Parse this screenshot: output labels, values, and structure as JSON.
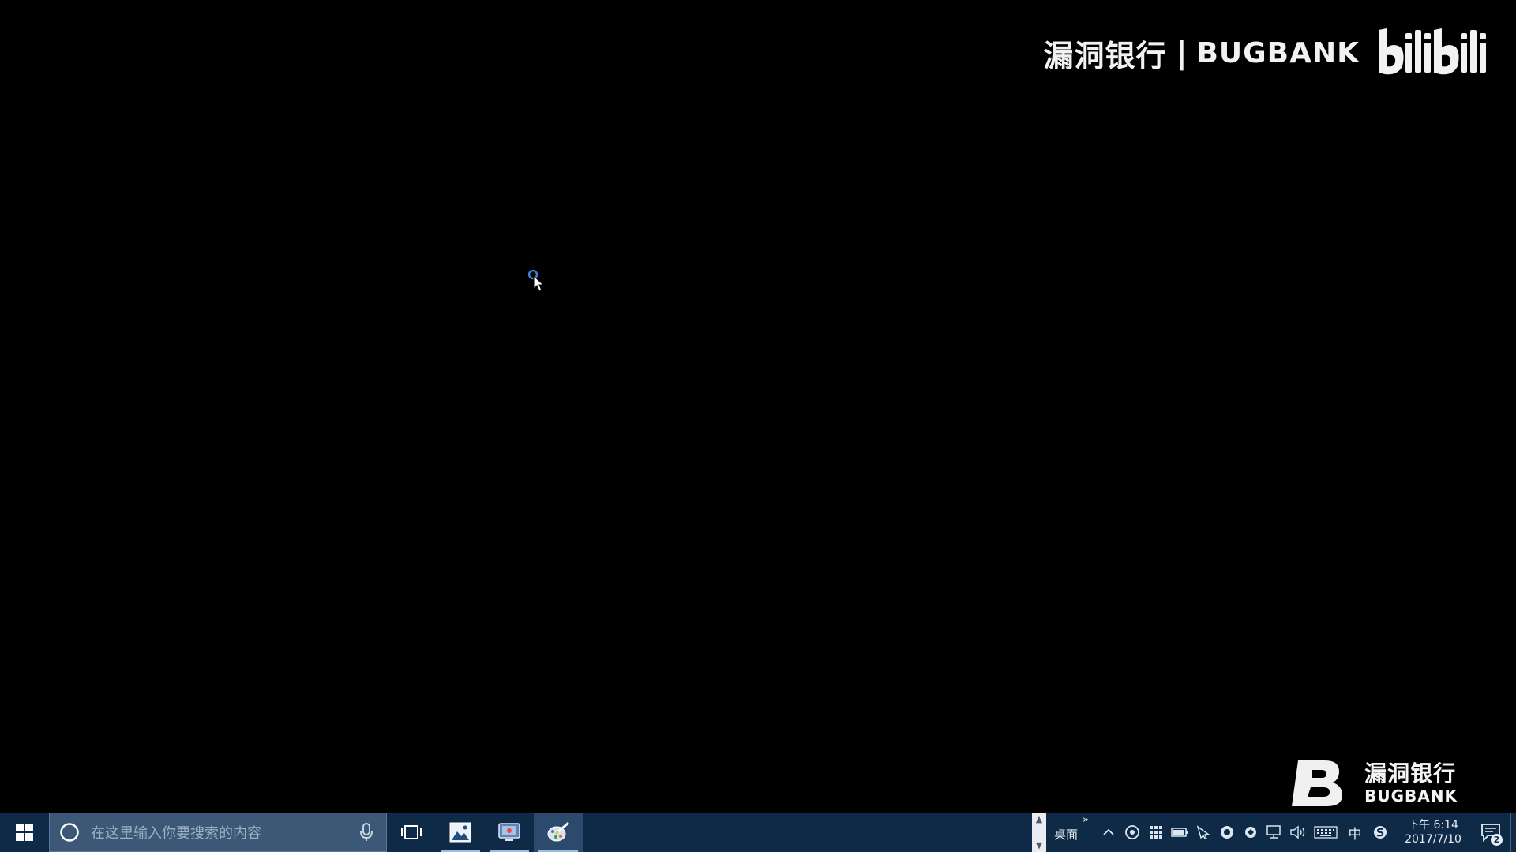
{
  "watermark_top": {
    "brand_cn": "漏洞银行",
    "separator": "|",
    "brand_en": "BUGBANK",
    "platform_logo": "bilibili-logo"
  },
  "watermark_bottom": {
    "logo_icon": "bugbank-b-logo",
    "brand_cn": "漏洞银行",
    "brand_en": "BUGBANK"
  },
  "taskbar": {
    "start_icon": "windows-logo-icon",
    "search": {
      "placeholder": "在这里输入你要搜索的内容",
      "icon": "cortana-ring-icon",
      "mic_icon": "microphone-icon"
    },
    "task_view_icon": "task-view-icon",
    "pinned_apps": [
      {
        "icon": "photos-icon",
        "running": true,
        "active": false
      },
      {
        "icon": "screen-recorder-icon",
        "running": true,
        "active": false
      },
      {
        "icon": "paint-app-icon",
        "running": true,
        "active": true
      }
    ],
    "desktop_toolbar": {
      "label": "桌面",
      "more": "»"
    },
    "tray": {
      "icons": [
        "show-hidden-icons-chevron",
        "network-security-icon",
        "grid-app-icon",
        "battery-icon",
        "pen-icon",
        "shield-icon",
        "sync-icon",
        "network-icon",
        "volume-icon",
        "keyboard-icon"
      ],
      "ime": "中",
      "input_method_icon": "sogou-icon"
    },
    "clock": {
      "time": "下午 6:14",
      "date": "2017/7/10"
    },
    "notifications": {
      "count": "2",
      "icon": "action-center-icon"
    }
  },
  "colors": {
    "desktop_background": "#000000",
    "taskbar_background": "#0e2a47",
    "search_background": "#3c5876",
    "watermark": "#f2f2f2"
  }
}
